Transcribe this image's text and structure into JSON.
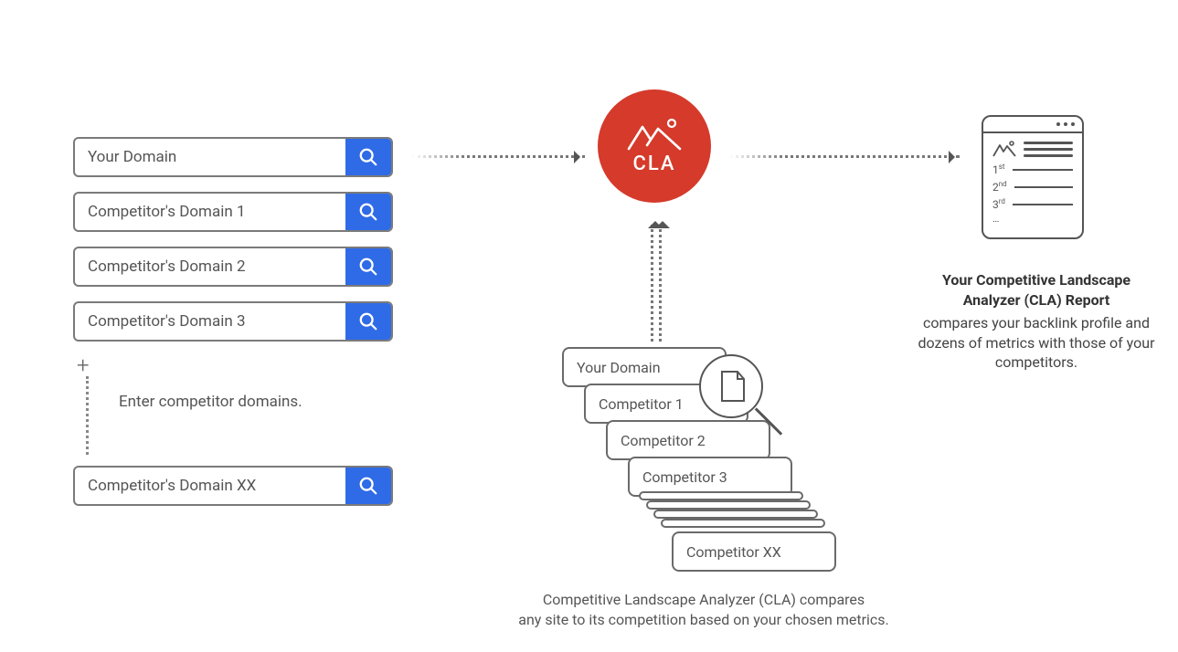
{
  "inputs": {
    "rows": [
      {
        "label": "Your Domain"
      },
      {
        "label": "Competitor's Domain 1"
      },
      {
        "label": "Competitor's Domain 2"
      },
      {
        "label": "Competitor's Domain 3"
      }
    ],
    "hint": "Enter competitor domains.",
    "last_row_label": "Competitor's Domain XX"
  },
  "cla": {
    "label": "CLA"
  },
  "stack": {
    "cards": [
      "Your Domain",
      "Competitor 1",
      "Competitor 2",
      "Competitor 3",
      "Competitor XX"
    ],
    "caption_line1": "Competitive Landscape Analyzer (CLA) compares",
    "caption_line2": "any site to its competition based on your chosen metrics."
  },
  "report": {
    "ranks": [
      "1",
      "2",
      "3"
    ],
    "rank_suffixes": [
      "st",
      "nd",
      "rd"
    ],
    "title": "Your Competitive Landscape Analyzer (CLA) Report",
    "desc": "compares your backlink profile and dozens of metrics with those of your competitors."
  }
}
